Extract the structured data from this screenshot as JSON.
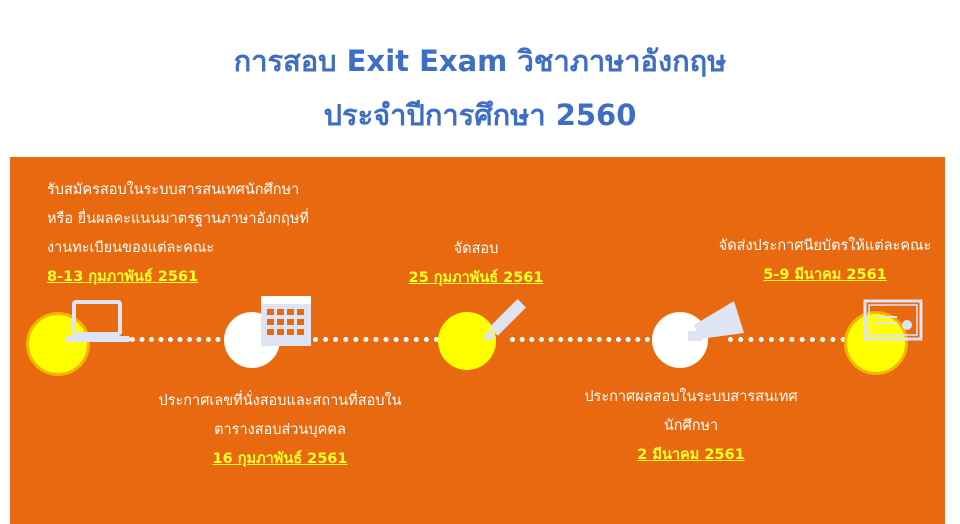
{
  "header": {
    "title_line1": "การสอบ Exit Exam วิชาภาษาอังกฤษ",
    "title_line2": "ประจำปีการศึกษา 2560"
  },
  "timeline": {
    "step1": {
      "line1": "รับสมัครสอบในระบบสารสนเทศนักศึกษา",
      "line2": "หรือ ยื่นผลคะแนนมาตรฐานภาษาอังกฤษที่",
      "line3": "งานทะเบียนของแต่ละคณะ",
      "date": "8-13 กุมภาพันธ์ 2561",
      "icon": "laptop-icon"
    },
    "step2": {
      "line1": "ประกาศเลขที่นั่งสอบและสถานที่สอบใน",
      "line2": "ตารางสอบส่วนบุคคล",
      "date": "16 กุมภาพันธ์ 2561",
      "icon": "calendar-icon"
    },
    "step3": {
      "line1": "จัดสอบ",
      "date": "25 กุมภาพันธ์ 2561",
      "icon": "pencil-icon"
    },
    "step4": {
      "line1": "ประกาศผลสอบในระบบสารสนเทศ",
      "line2": "นักศึกษา",
      "date": "2 มีนาคม 2561",
      "icon": "megaphone-icon"
    },
    "step5": {
      "line1": "จัดส่งประกาศนียบัตรให้แต่ละคณะ",
      "date": "5-9 มีนาคม 2561",
      "icon": "certificate-icon"
    }
  },
  "colors": {
    "title": "#3e6fc4",
    "panel": "#e8690f",
    "date_text": "#ffff2a",
    "yellow_circle": "#ffff00",
    "yellow_ring": "#f5b400"
  }
}
